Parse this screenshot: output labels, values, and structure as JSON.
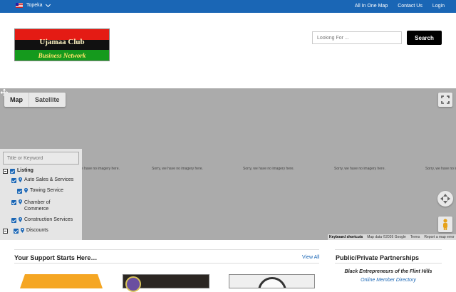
{
  "topbar": {
    "location": "Topeka",
    "links": [
      "All In One Map",
      "Contact Us",
      "Login"
    ]
  },
  "logo": {
    "line1": "Ujamaa Club",
    "line2": "Business Network"
  },
  "search": {
    "placeholder": "Looking For ...",
    "button": "Search"
  },
  "map": {
    "type_buttons": [
      "Map",
      "Satellite"
    ],
    "no_imagery": "Sorry, we have no imagery here.",
    "attribution": {
      "shortcuts": "Keyboard shortcuts",
      "data": "Map data ©2026 Google",
      "terms": "Terms",
      "report": "Report a map error"
    }
  },
  "filter_panel": {
    "keyword_placeholder": "Title or Keyword",
    "root": "Listing",
    "categories": [
      {
        "label": "Auto Sales & Services",
        "indent": 0
      },
      {
        "label": "Towing Service",
        "indent": 1
      },
      {
        "label": "Chamber of Commerce",
        "indent": 0
      },
      {
        "label": "Construction Services",
        "indent": 0
      },
      {
        "label": "Discounts",
        "indent": 0
      }
    ]
  },
  "support": {
    "title": "Your Support Starts Here…",
    "view_all": "View All"
  },
  "partnerships": {
    "title": "Public/Private Partnerships",
    "subtitle": "Black Entrepreneurs of the Flint Hills",
    "link": "Online Member Directory"
  },
  "colors": {
    "primary": "#1a66b5",
    "map_bg": "#ababab"
  }
}
